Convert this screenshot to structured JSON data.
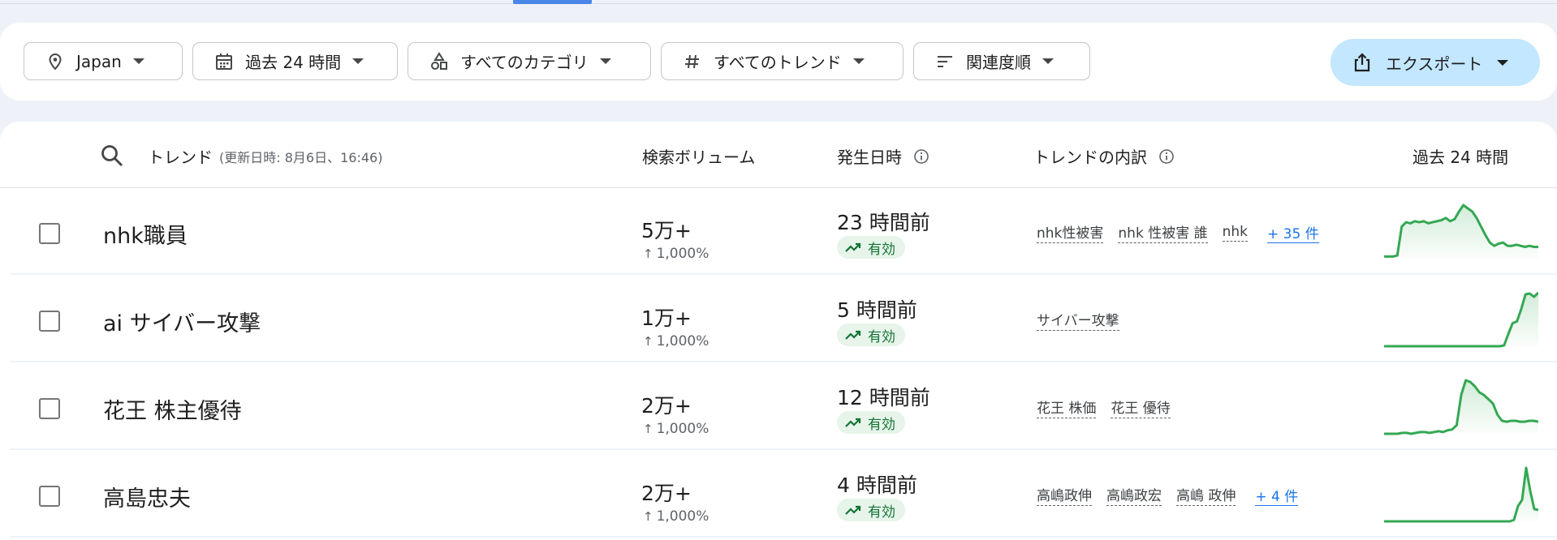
{
  "filters": {
    "location": "Japan",
    "time_range": "過去 24 時間",
    "category": "すべてのカテゴリ",
    "trend_type": "すべてのトレンド",
    "sort": "関連度順",
    "export": "エクスポート"
  },
  "table": {
    "headers": {
      "trend": "トレンド",
      "updated": "(更新日時: 8月6日、16:46)",
      "volume": "検索ボリューム",
      "started": "発生日時",
      "breakdown": "トレンドの内訳",
      "last24": "過去 24 時間"
    },
    "rows": [
      {
        "name": "nhk職員",
        "volume": "5万+",
        "pct": "1,000%",
        "started": "23 時間前",
        "status": "有効",
        "breakdown": [
          "nhk性被害",
          "nhk 性被害 誰",
          "nhk"
        ],
        "more": "+ 35 件",
        "spark": [
          2,
          2,
          2,
          3,
          30,
          34,
          33,
          35,
          34,
          35,
          33,
          34,
          35,
          36,
          38,
          35,
          37,
          44,
          50,
          47,
          44,
          38,
          30,
          22,
          15,
          12,
          14,
          15,
          12,
          12,
          13,
          12,
          11,
          12,
          11,
          11
        ]
      },
      {
        "name": "ai サイバー攻撃",
        "volume": "1万+",
        "pct": "1,000%",
        "started": "5 時間前",
        "status": "有効",
        "breakdown": [
          "サイバー攻撃"
        ],
        "more": "",
        "spark": [
          0,
          0,
          0,
          0,
          0,
          0,
          0,
          0,
          0,
          0,
          0,
          0,
          0,
          0,
          0,
          0,
          0,
          0,
          0,
          0,
          0,
          0,
          0,
          0,
          0,
          0,
          0,
          0,
          1,
          15,
          28,
          30,
          45,
          63,
          64,
          60,
          65
        ]
      },
      {
        "name": "花王 株主優待",
        "volume": "2万+",
        "pct": "1,000%",
        "started": "12 時間前",
        "status": "有効",
        "breakdown": [
          "花王 株価",
          "花王 優待"
        ],
        "more": "",
        "spark": [
          0,
          0,
          0,
          0,
          1,
          1,
          0,
          1,
          2,
          2,
          1,
          2,
          3,
          2,
          4,
          5,
          10,
          45,
          62,
          60,
          55,
          48,
          45,
          40,
          35,
          22,
          15,
          14,
          15,
          15,
          14,
          14,
          15,
          15,
          14
        ]
      },
      {
        "name": "高島忠夫",
        "volume": "2万+",
        "pct": "1,000%",
        "started": "4 時間前",
        "status": "有効",
        "breakdown": [
          "高嶋政伸",
          "高嶋政宏",
          "高嶋 政伸"
        ],
        "more": "+ 4 件",
        "spark": [
          0,
          0,
          0,
          0,
          0,
          0,
          0,
          0,
          0,
          0,
          0,
          0,
          0,
          0,
          0,
          0,
          0,
          0,
          0,
          0,
          0,
          0,
          0,
          0,
          0,
          0,
          0,
          0,
          0,
          0,
          0,
          0,
          2,
          20,
          28,
          70,
          40,
          16,
          15
        ]
      }
    ]
  },
  "colors": {
    "spark_line": "#34a853",
    "status_text": "#137333",
    "link": "#1a73e8",
    "export_bg": "#c2e7ff"
  },
  "icons": {
    "location": "pin-icon",
    "time": "calendar-icon",
    "category": "shapes-icon",
    "trend_type": "hash-icon",
    "sort": "sort-icon",
    "export": "share-icon"
  }
}
